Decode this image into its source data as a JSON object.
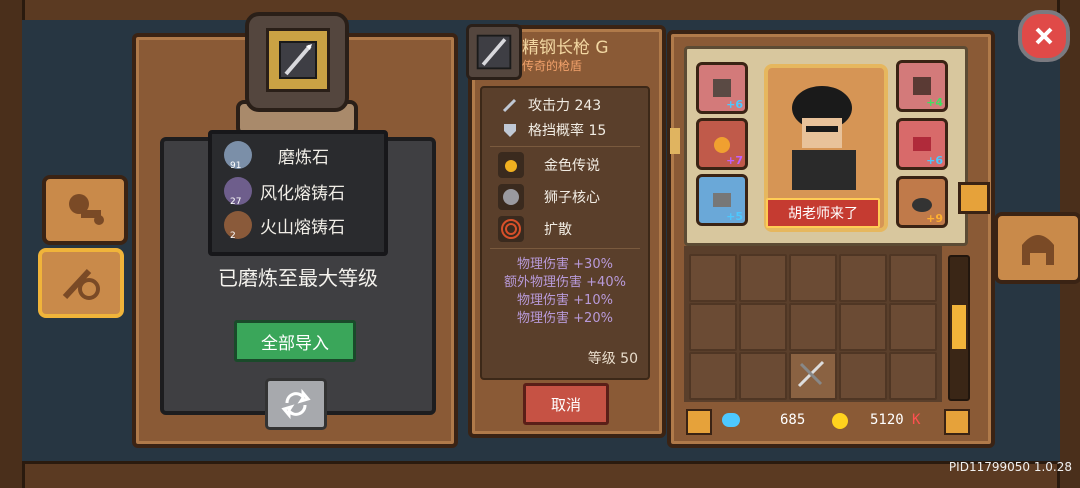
{
  "left_panel": {
    "materials": [
      {
        "name": "磨炼石",
        "count": "91"
      },
      {
        "name": "风化熔铸石",
        "count": "27"
      },
      {
        "name": "火山熔铸石",
        "count": "2"
      }
    ],
    "status_text": "已磨炼至最大等级",
    "import_all_label": "全部导入",
    "swap_icon": "refresh-icon"
  },
  "weapon": {
    "name": "精钢长枪 G",
    "subtitle": "传奇的枪盾",
    "stats": [
      {
        "label": "攻击力 243",
        "icon": "sword-icon"
      },
      {
        "label": "格挡概率 15",
        "icon": "shield-icon"
      }
    ],
    "perks": [
      {
        "label": "金色传说",
        "icon": "flame-icon"
      },
      {
        "label": "狮子核心",
        "icon": "lion-icon"
      },
      {
        "label": "扩散",
        "icon": "spiral-icon"
      }
    ],
    "bonuses": [
      "物理伤害 +30%",
      "额外物理伤害 +40%",
      "物理伤害 +10%",
      "物理伤害 +20%"
    ],
    "level": "等级 50",
    "cancel_label": "取消"
  },
  "character": {
    "name": "胡老师来了",
    "gear": [
      {
        "plus": "+6"
      },
      {
        "plus": "+7"
      },
      {
        "plus": "+5"
      },
      {
        "plus": "+4"
      },
      {
        "plus": "+6"
      },
      {
        "plus": "+9"
      }
    ]
  },
  "currency": {
    "gems": "685",
    "gold": "5120",
    "gold_suffix": "K"
  },
  "build_id": "PID11799050 1.0.28",
  "colors": {
    "accent": "#f2b43a",
    "close": "#e04a48",
    "import": "#3aa65a",
    "cancel": "#c65244"
  }
}
